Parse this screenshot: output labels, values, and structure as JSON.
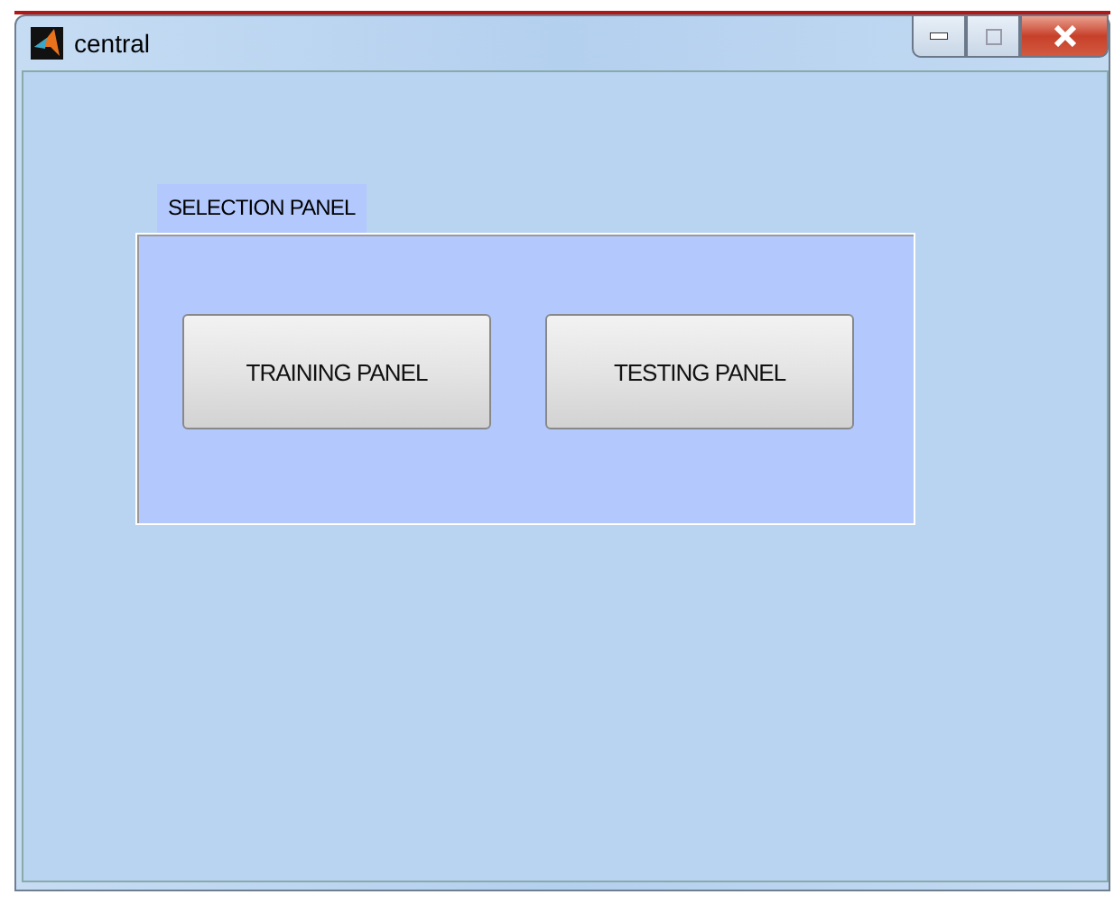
{
  "window": {
    "title": "central"
  },
  "panel": {
    "title": "SELECTION PANEL",
    "buttons": [
      {
        "label": "TRAINING PANEL"
      },
      {
        "label": "TESTING PANEL"
      }
    ]
  }
}
